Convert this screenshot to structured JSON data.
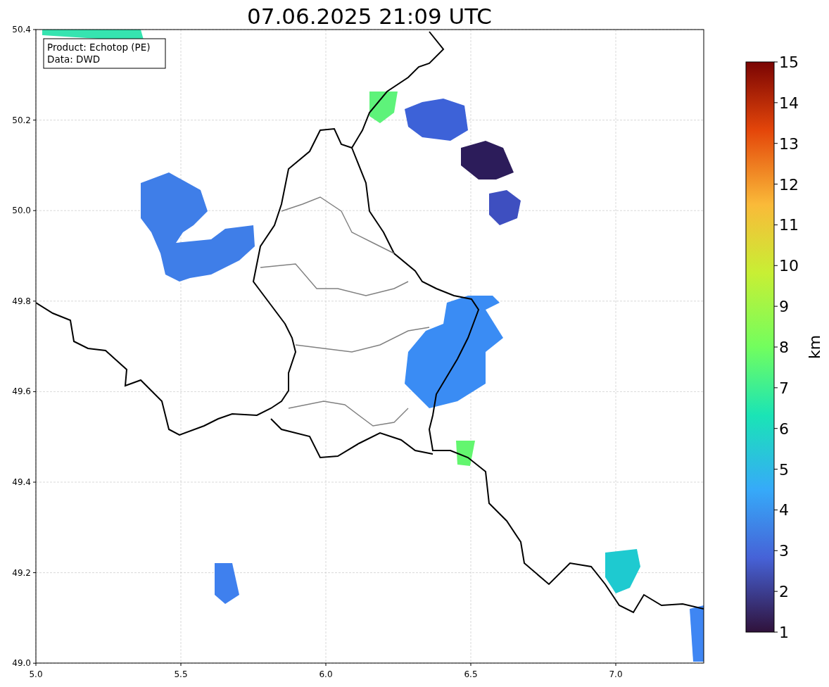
{
  "title": "07.06.2025 21:09 UTC",
  "info_box": {
    "lines": [
      "Product: Echotop (PE)",
      "Data: DWD"
    ]
  },
  "map": {
    "x_ticks": [
      "5.0",
      "5.5",
      "6.0",
      "6.5",
      "7.0"
    ],
    "y_ticks": [
      "50.4",
      "50.2",
      "50.0",
      "49.8",
      "49.6",
      "49.4",
      "49.2",
      "49.0"
    ]
  },
  "colorbar": {
    "label": "km",
    "ticks": [
      "15",
      "14",
      "13",
      "12",
      "11",
      "10",
      "9",
      "8",
      "7",
      "6",
      "5",
      "4",
      "3",
      "2",
      "1"
    ]
  }
}
